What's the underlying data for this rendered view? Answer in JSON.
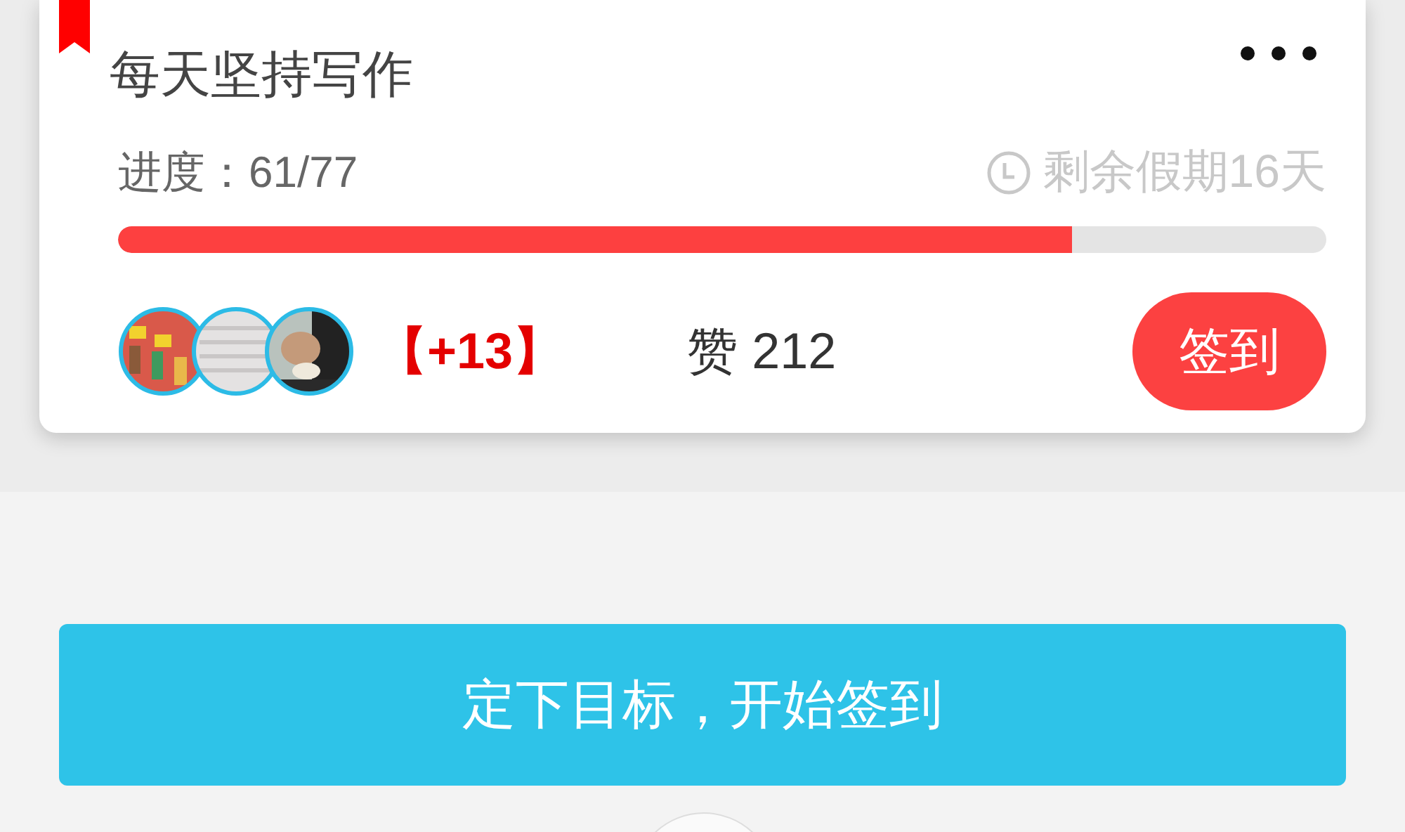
{
  "card": {
    "title": "每天坚持写作",
    "progress_label": "进度：61/77",
    "remaining": "剩余假期16天",
    "progress": {
      "level": 0.79
    },
    "more_count": "【+13】",
    "likes": "赞 212",
    "sign_button": "签到"
  },
  "start_button": "定下目标，开始签到"
}
